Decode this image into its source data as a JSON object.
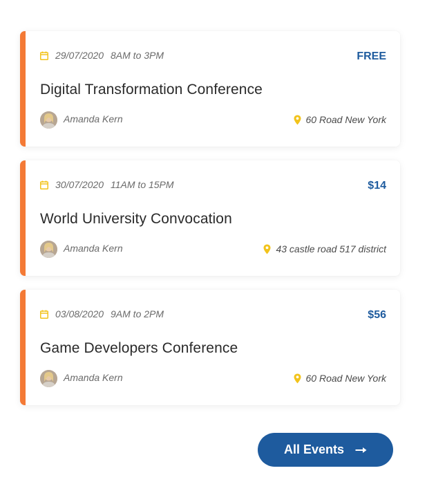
{
  "events": [
    {
      "date": "29/07/2020",
      "time": "8AM to 3PM",
      "price": "FREE",
      "title": "Digital Transformation Conference",
      "author": "Amanda Kern",
      "location": "60 Road New York"
    },
    {
      "date": "30/07/2020",
      "time": "11AM to 15PM",
      "price": "$14",
      "title": "World University Convocation",
      "author": "Amanda Kern",
      "location": "43 castle road 517 district"
    },
    {
      "date": "03/08/2020",
      "time": "9AM to 2PM",
      "price": "$56",
      "title": "Game Developers Conference",
      "author": "Amanda Kern",
      "location": "60 Road New York"
    }
  ],
  "all_events_button": {
    "label": "All Events",
    "icon": "arrow-right-icon"
  },
  "icons": {
    "date": "calendar-icon",
    "location": "map-pin-icon",
    "author": "avatar"
  },
  "colors": {
    "accent_border": "#f47a36",
    "brand_blue": "#1e5b9e",
    "icon_yellow": "#f2c31b",
    "title_text": "#2a2a2a",
    "meta_text": "#6a6a6a"
  }
}
